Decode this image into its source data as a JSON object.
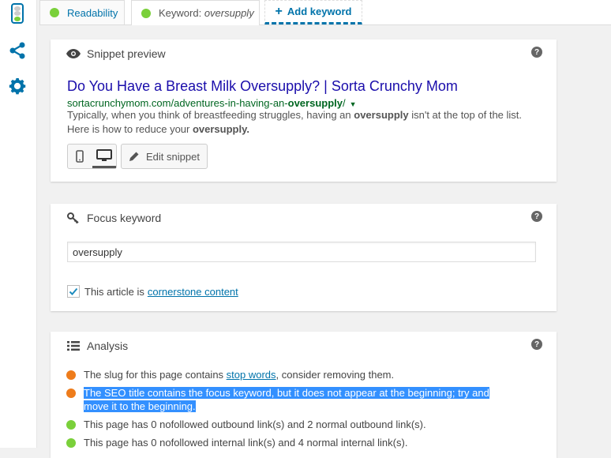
{
  "tabs": {
    "readability": "Readability",
    "keyword_prefix": "Keyword: ",
    "keyword_value": "oversupply",
    "add": "Add keyword"
  },
  "snippet": {
    "heading": "Snippet preview",
    "title": "Do You Have a Breast Milk Oversupply? | Sorta Crunchy Mom",
    "url_base": "sortacrunchymom.com/adventures-in-having-an-",
    "url_bold": "oversupply",
    "url_end": "/",
    "desc_1": "Typically, when you think of breastfeeding struggles, having an ",
    "desc_bold_1": "oversupply",
    "desc_2": " isn't at the top of the list. Here is how to reduce your ",
    "desc_bold_2": "oversupply.",
    "edit_label": "Edit snippet"
  },
  "focus": {
    "heading": "Focus keyword",
    "value": "oversupply",
    "cornerstone_text": "This article is",
    "cornerstone_link": "cornerstone content"
  },
  "analysis": {
    "heading": "Analysis",
    "item1_text": "The slug for this page contains ",
    "item1_link": "stop words",
    "item1_end": ", consider removing them.",
    "item2_line1": "The SEO title contains the focus keyword, but it does not appear at the beginning; try and",
    "item2_line2": "move it to the beginning.",
    "item3": "This page has 0 nofollowed outbound link(s) and 2 normal outbound link(s).",
    "item4": "This page has 0 nofollowed internal link(s) and 4 normal internal link(s)."
  },
  "colors": {
    "good": "#7ad03a",
    "ok": "#ee7c1b",
    "link": "#0073aa",
    "serp_title": "#1a0dab",
    "serp_url": "#006621"
  }
}
